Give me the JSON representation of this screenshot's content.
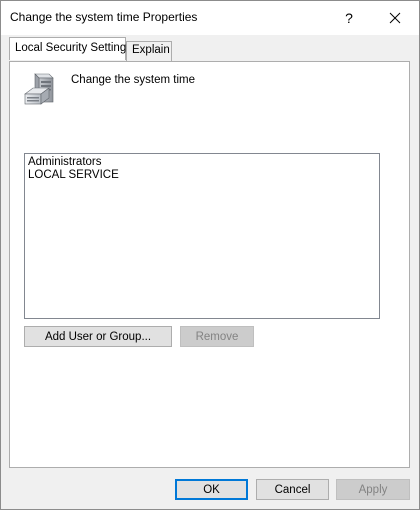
{
  "window": {
    "title": "Change the system time Properties",
    "help_glyph": "?"
  },
  "tabs": [
    {
      "label": "Local Security Setting",
      "selected": true
    },
    {
      "label": "Explain",
      "selected": false
    }
  ],
  "policy": {
    "icon": "server-tower-icon",
    "name": "Change the system time"
  },
  "assigned_accounts": [
    "Administrators",
    "LOCAL SERVICE"
  ],
  "panel_buttons": {
    "add_label": "Add User or Group...",
    "remove_label": "Remove",
    "remove_enabled": false
  },
  "dialog_buttons": {
    "ok_label": "OK",
    "cancel_label": "Cancel",
    "apply_label": "Apply",
    "apply_enabled": false
  },
  "colors": {
    "default_button_border": "#0078d7",
    "disabled_text": "#838383"
  }
}
